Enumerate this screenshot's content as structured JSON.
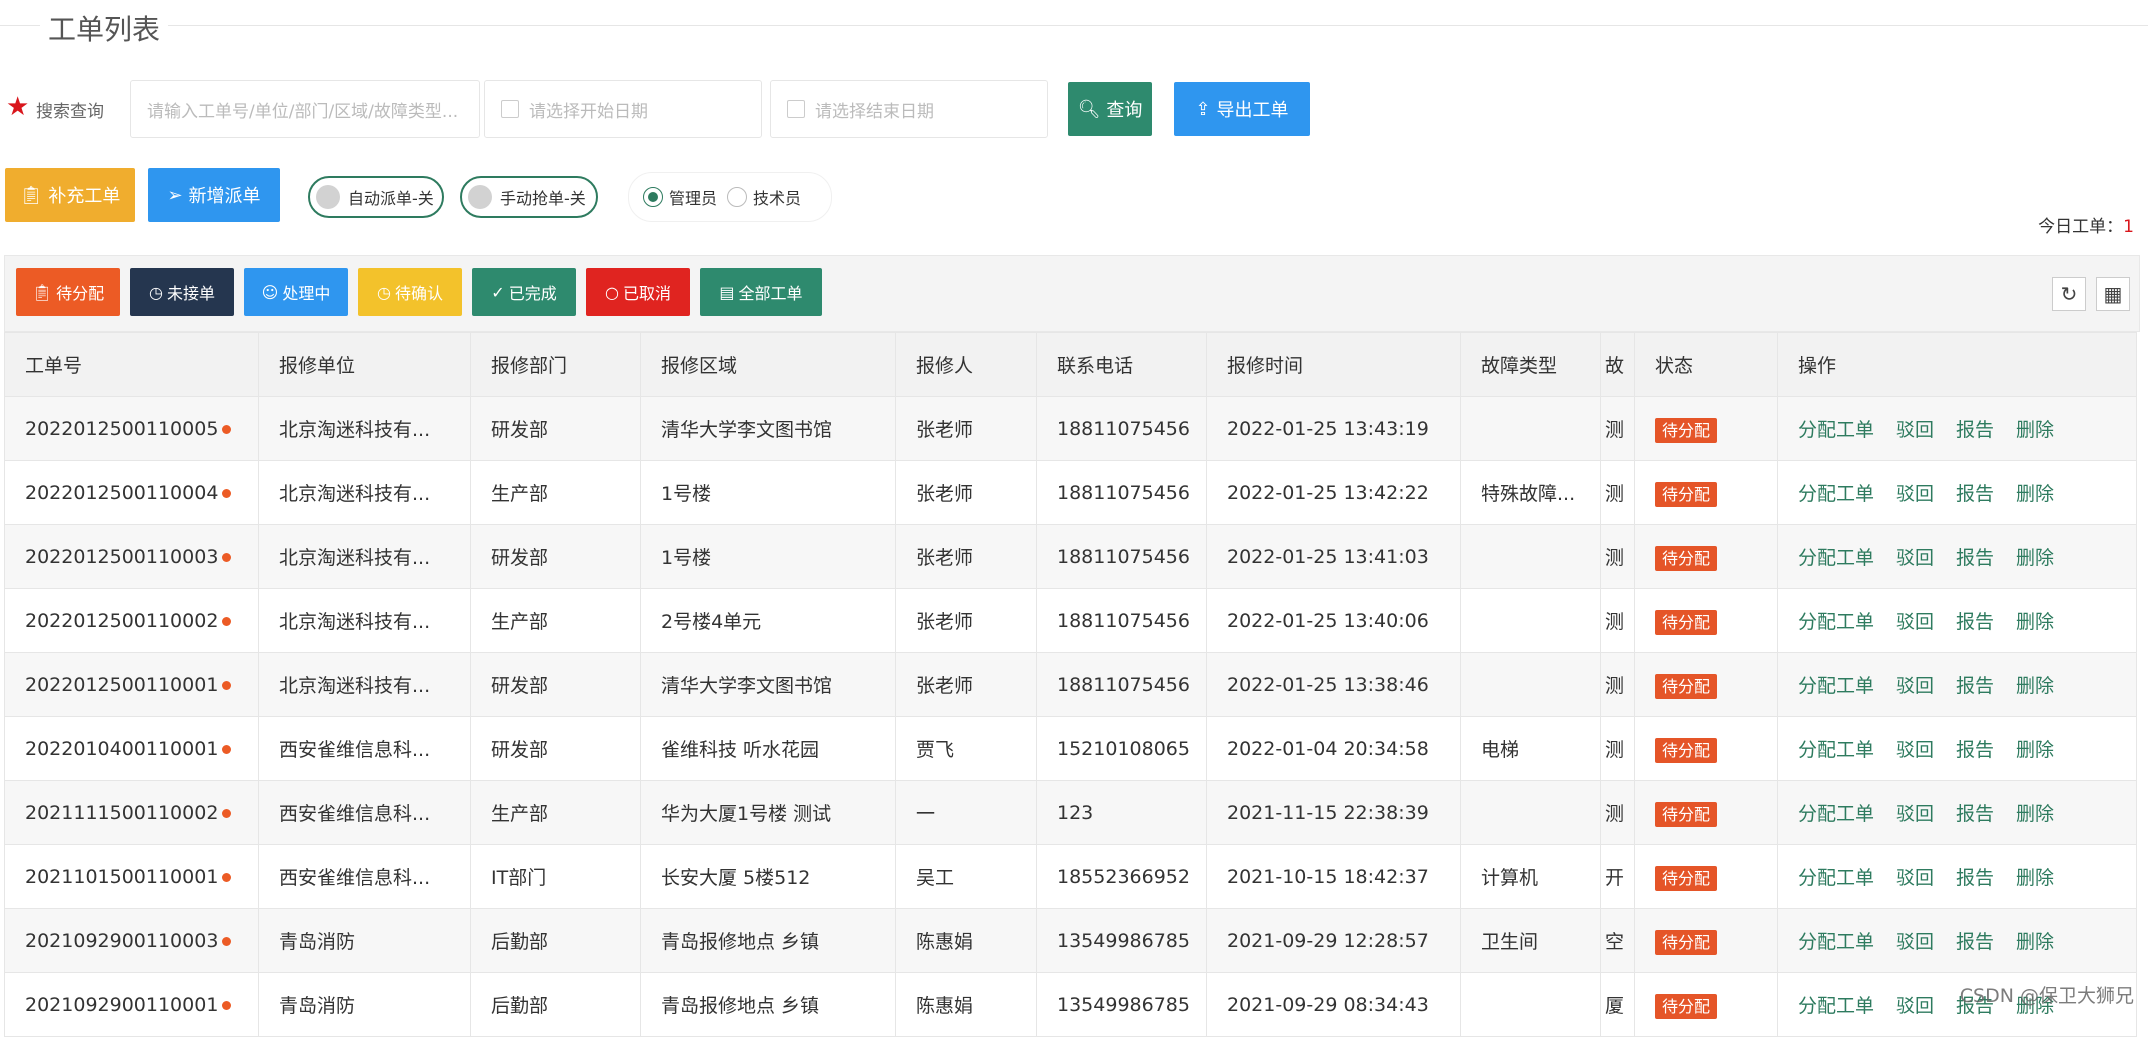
{
  "page_title": "工单列表",
  "search": {
    "label": "搜索查询",
    "keyword_placeholder": "请输入工单号/单位/部门/区域/故障类型...",
    "start_placeholder": "请选择开始日期",
    "end_placeholder": "请选择结束日期",
    "query_button": "查询",
    "export_button": "导出工单"
  },
  "actions": {
    "supplement": "补充工单",
    "new_dispatch": "新增派单",
    "auto_dispatch": "自动派单-关",
    "manual_grab": "手动抢单-关",
    "role_admin": "管理员",
    "role_tech": "技术员",
    "selected_role": "管理员"
  },
  "today": {
    "label": "今日工单：",
    "count": "1"
  },
  "status_filters": [
    {
      "label": "待分配",
      "color": "#ec5b25"
    },
    {
      "label": "未接单",
      "color": "#25364f"
    },
    {
      "label": "处理中",
      "color": "#2f96ef"
    },
    {
      "label": "待确认",
      "color": "#f3c22b"
    },
    {
      "label": "已完成",
      "color": "#2e8a6e"
    },
    {
      "label": "已取消",
      "color": "#e02420"
    },
    {
      "label": "全部工单",
      "color": "#2e8a6e"
    }
  ],
  "columns": [
    "工单号",
    "报修单位",
    "报修部门",
    "报修区域",
    "报修人",
    "联系电话",
    "报修时间",
    "故障类型",
    "故",
    "状态",
    "操作"
  ],
  "row_actions": [
    "分配工单",
    "驳回",
    "报告",
    "删除"
  ],
  "rows": [
    [
      "2022012500110005",
      "北京淘迷科技有...",
      "研发部",
      "清华大学李文图书馆",
      "张老师",
      "18811075456",
      "2022-01-25 13:43:19",
      "",
      "测",
      "待分配"
    ],
    [
      "2022012500110004",
      "北京淘迷科技有...",
      "生产部",
      "1号楼",
      "张老师",
      "18811075456",
      "2022-01-25 13:42:22",
      "特殊故障...",
      "测",
      "待分配"
    ],
    [
      "2022012500110003",
      "北京淘迷科技有...",
      "研发部",
      "1号楼",
      "张老师",
      "18811075456",
      "2022-01-25 13:41:03",
      "",
      "测",
      "待分配"
    ],
    [
      "2022012500110002",
      "北京淘迷科技有...",
      "生产部",
      "2号楼4单元",
      "张老师",
      "18811075456",
      "2022-01-25 13:40:06",
      "",
      "测",
      "待分配"
    ],
    [
      "2022012500110001",
      "北京淘迷科技有...",
      "研发部",
      "清华大学李文图书馆",
      "张老师",
      "18811075456",
      "2022-01-25 13:38:46",
      "",
      "测",
      "待分配"
    ],
    [
      "2022010400110001",
      "西安雀维信息科...",
      "研发部",
      "雀维科技 听水花园",
      "贾飞",
      "15210108065",
      "2022-01-04 20:34:58",
      "电梯",
      "测",
      "待分配"
    ],
    [
      "2021111500110002",
      "西安雀维信息科...",
      "生产部",
      "华为大厦1号楼 测试",
      "一",
      "123",
      "2021-11-15 22:38:39",
      "",
      "测",
      "待分配"
    ],
    [
      "2021101500110001",
      "西安雀维信息科...",
      "IT部门",
      "长安大厦 5楼512",
      "吴工",
      "18552366952",
      "2021-10-15 18:42:37",
      "计算机",
      "开",
      "待分配"
    ],
    [
      "2021092900110003",
      "青岛消防",
      "后勤部",
      "青岛报修地点 乡镇",
      "陈惠娟",
      "13549986785",
      "2021-09-29 12:28:57",
      "卫生间",
      "空",
      "待分配"
    ],
    [
      "2021092900110001",
      "青岛消防",
      "后勤部",
      "青岛报修地点 乡镇",
      "陈惠娟",
      "13549986785",
      "2021-09-29 08:34:43",
      "",
      "厦",
      "待分配"
    ]
  ],
  "watermark": "CSDN @保卫大狮兄"
}
